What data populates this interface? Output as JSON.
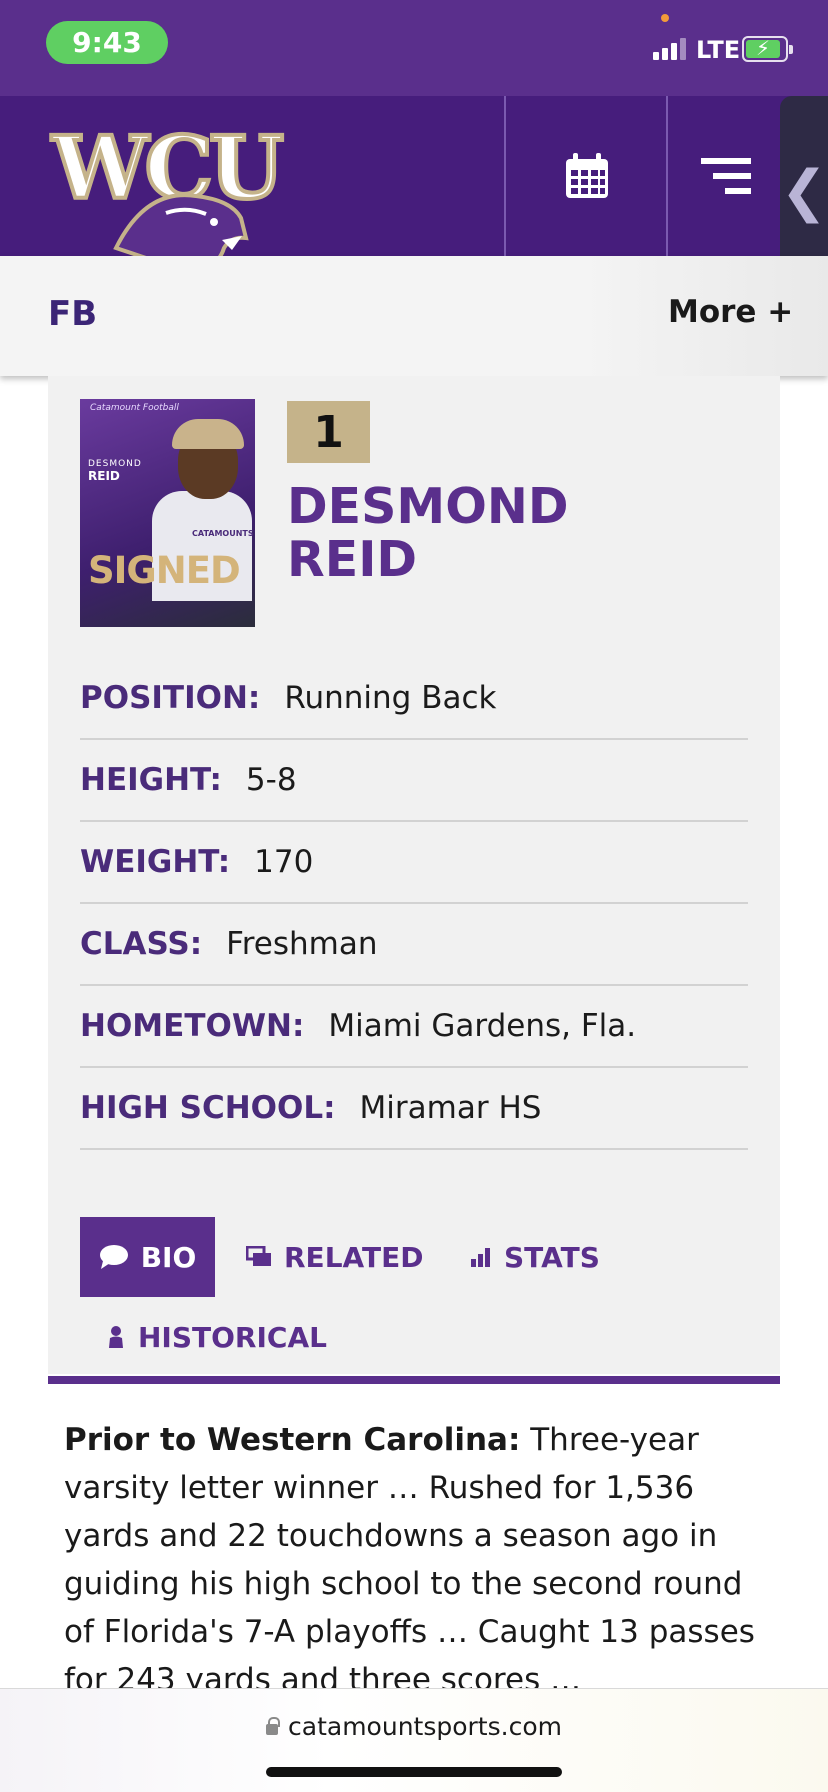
{
  "status": {
    "time": "9:43",
    "network": "LTE"
  },
  "header": {
    "logo_text": "WCU",
    "calendar_icon": "calendar-icon",
    "menu_icon": "menu-lines-icon",
    "side_tab_icon": "chevron-left-icon"
  },
  "subnav": {
    "title": "FB",
    "more": "More +"
  },
  "player": {
    "number": "1",
    "first_name": "DESMOND",
    "last_name": "REID",
    "photo": {
      "title": "Catamount Football",
      "name1": "DESMOND",
      "name2": "REID",
      "jersey": "CATAMOUNTS",
      "banner": "SIGNED"
    }
  },
  "attributes": [
    {
      "label": "POSITION:",
      "value": "Running Back"
    },
    {
      "label": "HEIGHT:",
      "value": "5-8"
    },
    {
      "label": "WEIGHT:",
      "value": "170"
    },
    {
      "label": "CLASS:",
      "value": "Freshman"
    },
    {
      "label": "HOMETOWN:",
      "value": "Miami Gardens, Fla."
    },
    {
      "label": "HIGH SCHOOL:",
      "value": "Miramar HS"
    }
  ],
  "tabs": [
    {
      "label": "BIO",
      "icon": "chat-bubble-icon",
      "active": true
    },
    {
      "label": "RELATED",
      "icon": "gallery-icon",
      "active": false
    },
    {
      "label": "STATS",
      "icon": "bar-chart-icon",
      "active": false
    },
    {
      "label": "HISTORICAL",
      "icon": "person-icon",
      "active": false
    }
  ],
  "bio": {
    "lead": "Prior to Western Carolina:",
    "text": " Three-year varsity letter winner … Rushed for 1,536 yards and 22 touchdowns a season ago in guiding his high school to the second round of Florida's 7-A playoffs … Caught 13 passes for 243 yards and three scores …"
  },
  "browser": {
    "url": "catamountsports.com"
  },
  "colors": {
    "purple": "#5a2f8c",
    "dark_purple": "#461d7c",
    "gold": "#c5b38a",
    "green": "#5fcf62"
  }
}
